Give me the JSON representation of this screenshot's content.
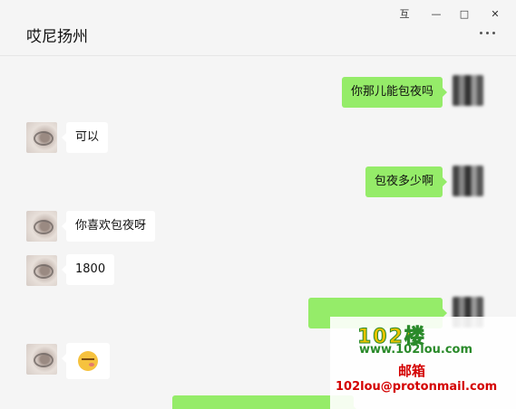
{
  "window": {
    "title": "哎尼扬州",
    "pin_label": "互",
    "minimize_label": "—",
    "maximize_label": "□",
    "close_label": "✕"
  },
  "messages": [
    {
      "side": "right",
      "text": "你那儿能包夜吗"
    },
    {
      "side": "left",
      "text": "可以"
    },
    {
      "side": "right",
      "text": "包夜多少啊"
    },
    {
      "side": "left",
      "text": "你喜欢包夜呀"
    },
    {
      "side": "left",
      "text": "1800"
    },
    {
      "side": "right",
      "text": "",
      "blurred": true
    },
    {
      "side": "left",
      "emoji": "smirk-face"
    },
    {
      "side": "right",
      "text": "",
      "blurred": true
    }
  ],
  "watermark": {
    "logo": "102楼",
    "url": "www.102lou.com",
    "mail_label": "邮箱",
    "mail": "102lou@protonmail.com"
  }
}
